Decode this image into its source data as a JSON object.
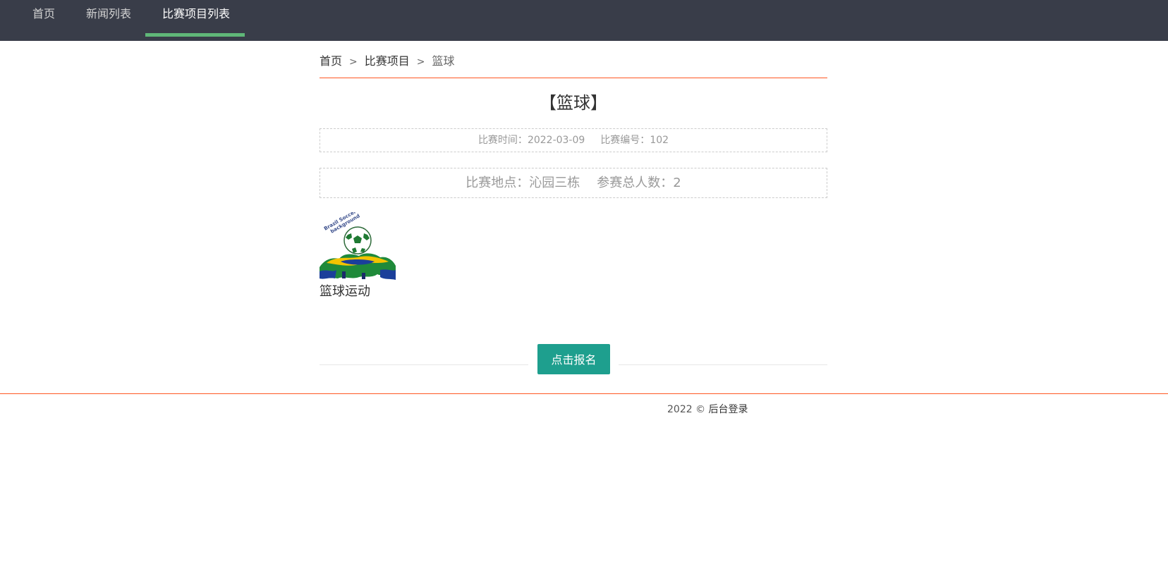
{
  "nav": {
    "items": [
      {
        "label": "首页",
        "active": false
      },
      {
        "label": "新闻列表",
        "active": false
      },
      {
        "label": "比赛项目列表",
        "active": true
      }
    ],
    "background": "#393d49",
    "active_underline_color": "#5fb878"
  },
  "breadcrumb": {
    "items": [
      "首页",
      "比赛项目",
      "篮球"
    ],
    "separator": ">",
    "line_color": "#ff5722"
  },
  "event": {
    "title": "【篮球】",
    "time_label": "比赛时间：",
    "time_value": "2022-03-09",
    "code_label": "比赛编号：",
    "code_value": "102",
    "location_label": "比赛地点：",
    "location_value": "沁园三栋",
    "participants_label": "参赛总人数：",
    "participants_value": "2",
    "image_caption": "篮球运动",
    "image_text": "Brazil Soccer background"
  },
  "action": {
    "signup_label": "点击报名",
    "button_color": "#1e9f8e"
  },
  "footer": {
    "copyright": "2022 © ",
    "admin_link": "后台登录"
  }
}
